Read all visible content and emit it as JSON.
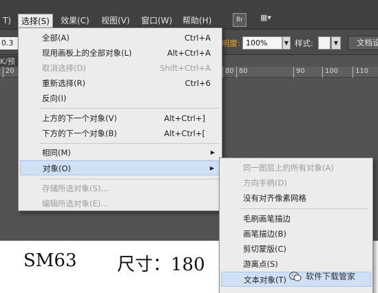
{
  "menubar": {
    "items": [
      "T)",
      "选择(S)",
      "效果(C)",
      "视图(V)",
      "窗口(W)",
      "帮助(H)"
    ],
    "bridge_icon": "Br",
    "arrange_icon": "▦▾"
  },
  "controlbar": {
    "left_value": "0.3",
    "opacity_label": "明度:",
    "opacity_value": "100%",
    "style_label": "样式:",
    "document_button": "文档设"
  },
  "document_tab": "K/预",
  "ruler": {
    "labels": [
      "20",
      "80",
      "90",
      "100",
      "110"
    ]
  },
  "canvas_text": {
    "left": "SM63",
    "right": "尺寸：180"
  },
  "select_menu": {
    "items": [
      {
        "label": "全部(A)",
        "shortcut": "Ctrl+A"
      },
      {
        "label": "现用画板上的全部对象(L)",
        "shortcut": "Alt+Ctrl+A"
      },
      {
        "label": "取消选择(D)",
        "shortcut": "Shift+Ctrl+A"
      },
      {
        "label": "重新选择(R)",
        "shortcut": "Ctrl+6"
      },
      {
        "label": "反向(I)",
        "shortcut": ""
      },
      {
        "label": "上方的下一个对象(V)",
        "shortcut": "Alt+Ctrl+]"
      },
      {
        "label": "下方的下一个对象(B)",
        "shortcut": "Alt+Ctrl+["
      },
      {
        "label": "相同(M)",
        "shortcut": ""
      },
      {
        "label": "对象(O)",
        "shortcut": ""
      },
      {
        "label": "存储所选对象(S)...",
        "shortcut": ""
      },
      {
        "label": "编辑所选对象(E)...",
        "shortcut": ""
      }
    ]
  },
  "object_submenu": {
    "items": [
      {
        "label": "同一图层上的所有对象(A)"
      },
      {
        "label": "方向手柄(D)"
      },
      {
        "label": "没有对齐像素网格"
      },
      {
        "label": "毛刷画笔描边"
      },
      {
        "label": "画笔描边(B)"
      },
      {
        "label": "剪切蒙版(C)"
      },
      {
        "label": "游离点(S)"
      },
      {
        "label": "文本对象(T)"
      }
    ]
  },
  "watermark": {
    "text": "软件下载管家"
  },
  "colors": {
    "menu_bg": "#ececec",
    "highlight": "#cfe0f5",
    "disabled_text": "#9c9c9c",
    "opacity_label": "#f5a623",
    "app_bg": "#535353"
  }
}
